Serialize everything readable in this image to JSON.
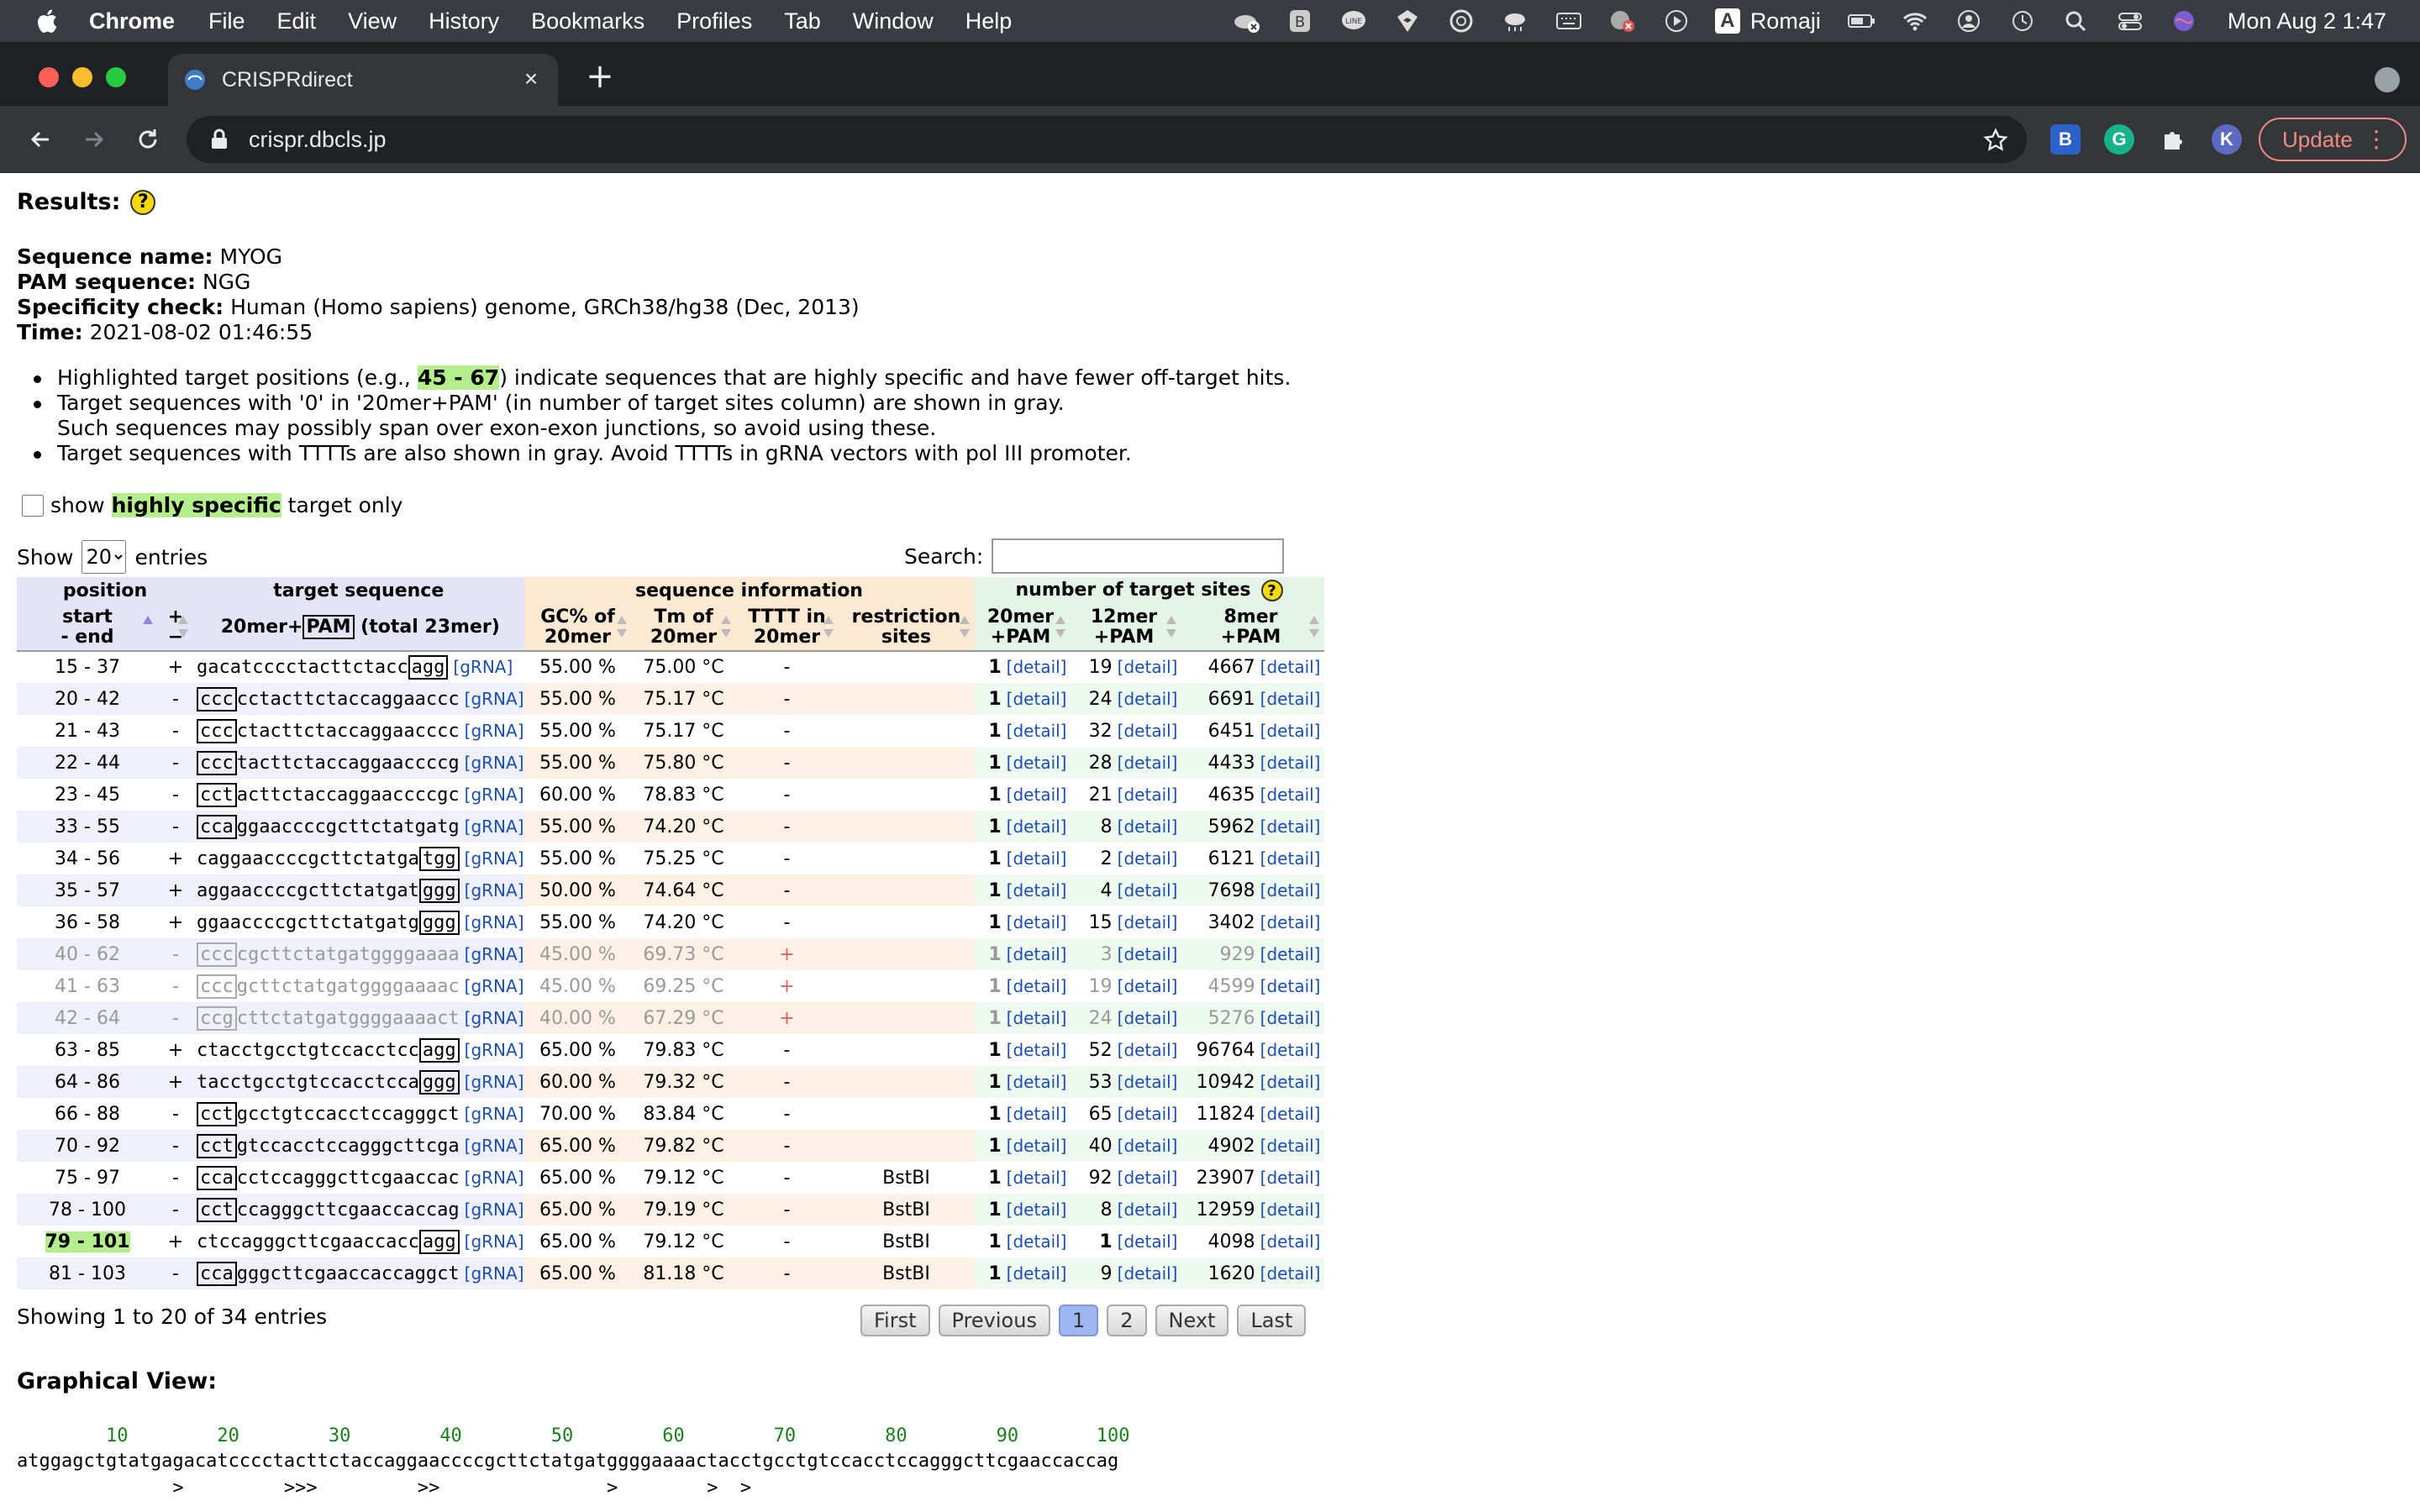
{
  "menubar": {
    "app_name": "Chrome",
    "items": [
      "File",
      "Edit",
      "View",
      "History",
      "Bookmarks",
      "Profiles",
      "Tab",
      "Window",
      "Help"
    ],
    "input_method": "Romaji",
    "clock": "Mon Aug 2  1:47"
  },
  "tabs": [
    {
      "title": "CRISPRdirect"
    }
  ],
  "toolbar": {
    "url": "crispr.dbcls.jp",
    "profile_initial": "K",
    "update_label": "Update"
  },
  "results": {
    "heading": "Results:",
    "meta": [
      {
        "label": "Sequence name:",
        "value": "MYOG"
      },
      {
        "label": "PAM sequence:",
        "value": "NGG"
      },
      {
        "label": "Specificity check:",
        "value": "Human (Homo sapiens) genome, GRCh38/hg38 (Dec, 2013)"
      },
      {
        "label": "Time:",
        "value": "2021-08-02 01:46:55"
      }
    ],
    "notes": {
      "n1_pre": "Highlighted target positions (e.g., ",
      "n1_hl": "45 - 67",
      "n1_post": ") indicate sequences that are highly specific and have fewer off-target hits.",
      "n2_line1": "Target sequences with '0' in '20mer+PAM' (in number of target sites column) are shown in gray.",
      "n2_line2": "Such sequences may possibly span over exon-exon junctions, so avoid using these.",
      "n3": "Target sequences with TTTTs are also shown in gray. Avoid TTTTs in gRNA vectors with pol III promoter."
    },
    "filter": {
      "pre": "show",
      "hl": "highly specific",
      "post": "target only"
    },
    "show_label": "Show",
    "entries_value": "20",
    "entries_label": "entries",
    "search_label": "Search:",
    "search_value": ""
  },
  "table": {
    "groups": [
      "position",
      "target sequence",
      "sequence information",
      "number of target sites"
    ],
    "columns": {
      "start_end": "start\n- end",
      "strand": "+\n−",
      "seq_pre": "20mer+",
      "seq_pam": "PAM",
      "seq_post": " (total 23mer)",
      "gc": "GC% of\n20mer",
      "tm": "Tm of\n20mer",
      "tttt": "TTTT in\n20mer",
      "restriction": "restriction\nsites",
      "m20": "20mer\n+PAM",
      "m12": "12mer\n+PAM",
      "m8": "8mer\n+PAM"
    },
    "grna_label": "[gRNA]",
    "detail_label": "[detail]",
    "rows": [
      {
        "pos": "15 - 37",
        "strand": "+",
        "pam_left": "",
        "seq": "gacatcccctacttctacc",
        "pam_right": "agg",
        "gc": "55.00 %",
        "tm": "75.00 °C",
        "tttt": "-",
        "rs": "",
        "m20": "1",
        "m12": "19",
        "m8": "4667",
        "gray": false,
        "hl": false
      },
      {
        "pos": "20 - 42",
        "strand": "-",
        "pam_left": "ccc",
        "seq": "cctacttctaccaggaaccc",
        "pam_right": "",
        "gc": "55.00 %",
        "tm": "75.17 °C",
        "tttt": "-",
        "rs": "",
        "m20": "1",
        "m12": "24",
        "m8": "6691",
        "gray": false,
        "hl": false
      },
      {
        "pos": "21 - 43",
        "strand": "-",
        "pam_left": "ccc",
        "seq": "ctacttctaccaggaacccc",
        "pam_right": "",
        "gc": "55.00 %",
        "tm": "75.17 °C",
        "tttt": "-",
        "rs": "",
        "m20": "1",
        "m12": "32",
        "m8": "6451",
        "gray": false,
        "hl": false
      },
      {
        "pos": "22 - 44",
        "strand": "-",
        "pam_left": "ccc",
        "seq": "tacttctaccaggaaccccg",
        "pam_right": "",
        "gc": "55.00 %",
        "tm": "75.80 °C",
        "tttt": "-",
        "rs": "",
        "m20": "1",
        "m12": "28",
        "m8": "4433",
        "gray": false,
        "hl": false
      },
      {
        "pos": "23 - 45",
        "strand": "-",
        "pam_left": "cct",
        "seq": "acttctaccaggaaccccgc",
        "pam_right": "",
        "gc": "60.00 %",
        "tm": "78.83 °C",
        "tttt": "-",
        "rs": "",
        "m20": "1",
        "m12": "21",
        "m8": "4635",
        "gray": false,
        "hl": false
      },
      {
        "pos": "33 - 55",
        "strand": "-",
        "pam_left": "cca",
        "seq": "ggaaccccgcttctatgatg",
        "pam_right": "",
        "gc": "55.00 %",
        "tm": "74.20 °C",
        "tttt": "-",
        "rs": "",
        "m20": "1",
        "m12": "8",
        "m8": "5962",
        "gray": false,
        "hl": false
      },
      {
        "pos": "34 - 56",
        "strand": "+",
        "pam_left": "",
        "seq": "caggaaccccgcttctatga",
        "pam_right": "tgg",
        "gc": "55.00 %",
        "tm": "75.25 °C",
        "tttt": "-",
        "rs": "",
        "m20": "1",
        "m12": "2",
        "m8": "6121",
        "gray": false,
        "hl": false
      },
      {
        "pos": "35 - 57",
        "strand": "+",
        "pam_left": "",
        "seq": "aggaaccccgcttctatgat",
        "pam_right": "ggg",
        "gc": "50.00 %",
        "tm": "74.64 °C",
        "tttt": "-",
        "rs": "",
        "m20": "1",
        "m12": "4",
        "m8": "7698",
        "gray": false,
        "hl": false
      },
      {
        "pos": "36 - 58",
        "strand": "+",
        "pam_left": "",
        "seq": "ggaaccccgcttctatgatg",
        "pam_right": "ggg",
        "gc": "55.00 %",
        "tm": "74.20 °C",
        "tttt": "-",
        "rs": "",
        "m20": "1",
        "m12": "15",
        "m8": "3402",
        "gray": false,
        "hl": false
      },
      {
        "pos": "40 - 62",
        "strand": "-",
        "pam_left": "ccc",
        "seq": "cgcttctatgatggggaaaa",
        "pam_right": "",
        "gc": "45.00 %",
        "tm": "69.73 °C",
        "tttt": "+",
        "rs": "",
        "m20": "1",
        "m12": "3",
        "m8": "929",
        "gray": true,
        "hl": false
      },
      {
        "pos": "41 - 63",
        "strand": "-",
        "pam_left": "ccc",
        "seq": "gcttctatgatggggaaaac",
        "pam_right": "",
        "gc": "45.00 %",
        "tm": "69.25 °C",
        "tttt": "+",
        "rs": "",
        "m20": "1",
        "m12": "19",
        "m8": "4599",
        "gray": true,
        "hl": false
      },
      {
        "pos": "42 - 64",
        "strand": "-",
        "pam_left": "ccg",
        "seq": "cttctatgatggggaaaact",
        "pam_right": "",
        "gc": "40.00 %",
        "tm": "67.29 °C",
        "tttt": "+",
        "rs": "",
        "m20": "1",
        "m12": "24",
        "m8": "5276",
        "gray": true,
        "hl": false
      },
      {
        "pos": "63 - 85",
        "strand": "+",
        "pam_left": "",
        "seq": "ctacctgcctgtccacctcc",
        "pam_right": "agg",
        "gc": "65.00 %",
        "tm": "79.83 °C",
        "tttt": "-",
        "rs": "",
        "m20": "1",
        "m12": "52",
        "m8": "96764",
        "gray": false,
        "hl": false
      },
      {
        "pos": "64 - 86",
        "strand": "+",
        "pam_left": "",
        "seq": "tacctgcctgtccacctcca",
        "pam_right": "ggg",
        "gc": "60.00 %",
        "tm": "79.32 °C",
        "tttt": "-",
        "rs": "",
        "m20": "1",
        "m12": "53",
        "m8": "10942",
        "gray": false,
        "hl": false
      },
      {
        "pos": "66 - 88",
        "strand": "-",
        "pam_left": "cct",
        "seq": "gcctgtccacctccagggct",
        "pam_right": "",
        "gc": "70.00 %",
        "tm": "83.84 °C",
        "tttt": "-",
        "rs": "",
        "m20": "1",
        "m12": "65",
        "m8": "11824",
        "gray": false,
        "hl": false
      },
      {
        "pos": "70 - 92",
        "strand": "-",
        "pam_left": "cct",
        "seq": "gtccacctccagggcttcga",
        "pam_right": "",
        "gc": "65.00 %",
        "tm": "79.82 °C",
        "tttt": "-",
        "rs": "",
        "m20": "1",
        "m12": "40",
        "m8": "4902",
        "gray": false,
        "hl": false
      },
      {
        "pos": "75 - 97",
        "strand": "-",
        "pam_left": "cca",
        "seq": "cctccagggcttcgaaccac",
        "pam_right": "",
        "gc": "65.00 %",
        "tm": "79.12 °C",
        "tttt": "-",
        "rs": "BstBI",
        "m20": "1",
        "m12": "92",
        "m8": "23907",
        "gray": false,
        "hl": false
      },
      {
        "pos": "78 - 100",
        "strand": "-",
        "pam_left": "cct",
        "seq": "ccagggcttcgaaccaccag",
        "pam_right": "",
        "gc": "65.00 %",
        "tm": "79.19 °C",
        "tttt": "-",
        "rs": "BstBI",
        "m20": "1",
        "m12": "8",
        "m8": "12959",
        "gray": false,
        "hl": false
      },
      {
        "pos": "79 - 101",
        "strand": "+",
        "pam_left": "",
        "seq": "ctccagggcttcgaaccacc",
        "pam_right": "agg",
        "gc": "65.00 %",
        "tm": "79.12 °C",
        "tttt": "-",
        "rs": "BstBI",
        "m20": "1",
        "m12": "1",
        "m8": "4098",
        "gray": false,
        "hl": true
      },
      {
        "pos": "81 - 103",
        "strand": "-",
        "pam_left": "cca",
        "seq": "gggcttcgaaccaccaggct",
        "pam_right": "",
        "gc": "65.00 %",
        "tm": "81.18 °C",
        "tttt": "-",
        "rs": "BstBI",
        "m20": "1",
        "m12": "9",
        "m8": "1620",
        "gray": false,
        "hl": false
      }
    ]
  },
  "pagination": {
    "info": "Showing 1 to 20 of 34 entries",
    "buttons": [
      "First",
      "Previous",
      "1",
      "2",
      "Next",
      "Last"
    ],
    "current": "1"
  },
  "graphical_view": {
    "title": "Graphical View:",
    "ruler": "        10        20        30        40        50        60        70        80        90       100",
    "sequence": "atggagctgtatgagacatcccctacttctaccaggaaccccgcttctatgatggggaaaactacctgcctgtccacctccagggcttcgaaccaccag",
    "arrows": "              >         >>>         >>               >        >  >"
  },
  "colors": {
    "menubar_bg": "#3a3c43",
    "chrome_dark": "#202124",
    "chrome_toolbar": "#35363a",
    "highlight_green": "#b5ef8d",
    "position_header": "#e4e4f8",
    "seqinfo_header": "#fde8d2",
    "sites_header": "#e2f5e6",
    "link_blue": "#1a4fae",
    "update_red": "#f28b82"
  }
}
